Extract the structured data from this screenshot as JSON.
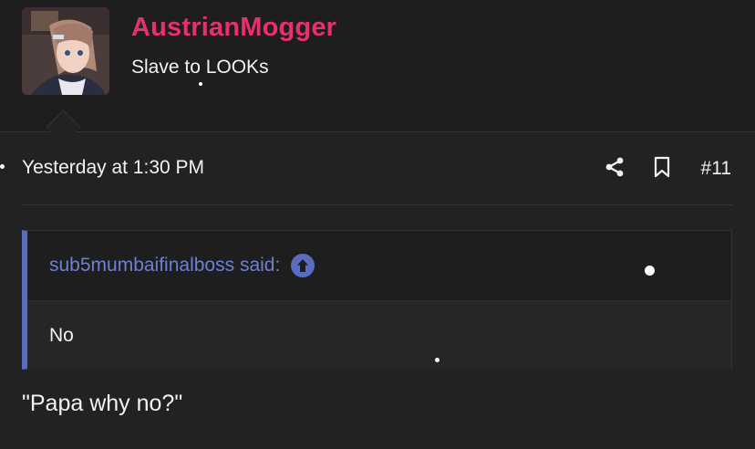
{
  "user": {
    "name": "AustrianMogger",
    "title": "Slave to LOOKs",
    "name_color": "#e8306b"
  },
  "post": {
    "date": "Yesterday at 1:30 PM",
    "number": "#11",
    "text": "\"Papa why no?\""
  },
  "quote": {
    "author_line": "sub5mumbaifinalboss said:",
    "body": "No",
    "accent_color": "#5a6cc0"
  },
  "icons": {
    "share": "share-icon",
    "bookmark": "bookmark-icon",
    "jump": "arrow-up-circle-icon"
  }
}
